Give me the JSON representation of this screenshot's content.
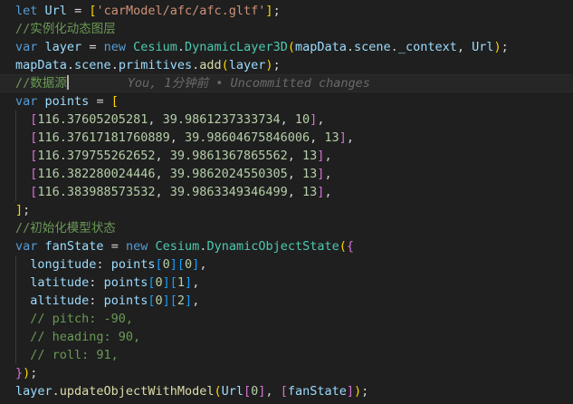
{
  "colors": {
    "background": "#1f1f1f",
    "keyword": "#569cd6",
    "variable": "#9cdcfe",
    "class": "#4ec9b0",
    "function": "#dcdcaa",
    "string": "#ce9178",
    "number": "#b5cea8",
    "comment": "#6a9955",
    "bracket_gold": "#ffd700",
    "bracket_orchid": "#da70d6",
    "bracket_blue": "#179fff"
  },
  "code": {
    "top_partial": "); ); ); ); ); )); ); ); ); ); ;",
    "l1": {
      "kw": "let",
      "name": "Url",
      "eq": "=",
      "open": "[",
      "str": "'carModel/afc/afc.gltf'",
      "close": "]",
      "semi": ";"
    },
    "l2": {
      "text": "//实例化动态图层"
    },
    "l3": {
      "kw": "var",
      "name": "layer",
      "eq": "=",
      "new_kw": "new",
      "ns": "Cesium",
      "dot": ".",
      "cls": "DynamicLayer3D",
      "open": "(",
      "a1": "mapData",
      "a2": "scene",
      "a3": "_context",
      "comma": ",",
      "a4": "Url",
      "close": ")",
      "semi": ";"
    },
    "l4": {
      "obj": "mapData",
      "prop1": "scene",
      "prop2": "primitives",
      "fn": "add",
      "open": "(",
      "arg": "layer",
      "close": ")",
      "semi": ";"
    },
    "l5": {
      "text": "//数据源",
      "blame": "You, 1分钟前 • Uncommitted changes"
    },
    "l6": {
      "kw": "var",
      "name": "points",
      "eq": "=",
      "open": "["
    },
    "points": [
      {
        "x": "116.37605205281",
        "y": "39.9861237333734",
        "z": "10",
        "sep": ","
      },
      {
        "x": "116.37617181760889",
        "y": "39.98604675846006",
        "z": "13",
        "sep": ","
      },
      {
        "x": "116.379755262652",
        "y": "39.9861367865562",
        "z": "13",
        "sep": ","
      },
      {
        "x": "116.382280024446",
        "y": "39.9862024550305",
        "z": "13",
        "sep": ","
      },
      {
        "x": "116.383988573532",
        "y": "39.9863349346499",
        "z": "13",
        "sep": ","
      }
    ],
    "l12": {
      "close": "]",
      "semi": ";"
    },
    "l13": {
      "text": "//初始化模型状态"
    },
    "l14": {
      "kw": "var",
      "name": "fanState",
      "eq": "=",
      "new_kw": "new",
      "ns": "Cesium",
      "cls": "DynamicObjectState",
      "open": "(",
      "brace": "{"
    },
    "props": [
      {
        "key": "longitude",
        "src": "points",
        "i": "0",
        "j": "0"
      },
      {
        "key": "latitude",
        "src": "points",
        "i": "0",
        "j": "1"
      },
      {
        "key": "altitude",
        "src": "points",
        "i": "0",
        "j": "2"
      }
    ],
    "comments": [
      {
        "text": "// pitch: -90,"
      },
      {
        "text": "// heading: 90,"
      },
      {
        "text": "// roll: 91,"
      }
    ],
    "l21": {
      "brace": "}",
      "close": ")",
      "semi": ";"
    },
    "l22": {
      "obj": "layer",
      "fn": "updateObjectWithModel",
      "open": "(",
      "a1": "Url",
      "idx": "0",
      "comma": ",",
      "a2": "fanState",
      "close": ")",
      "semi": ";"
    }
  }
}
